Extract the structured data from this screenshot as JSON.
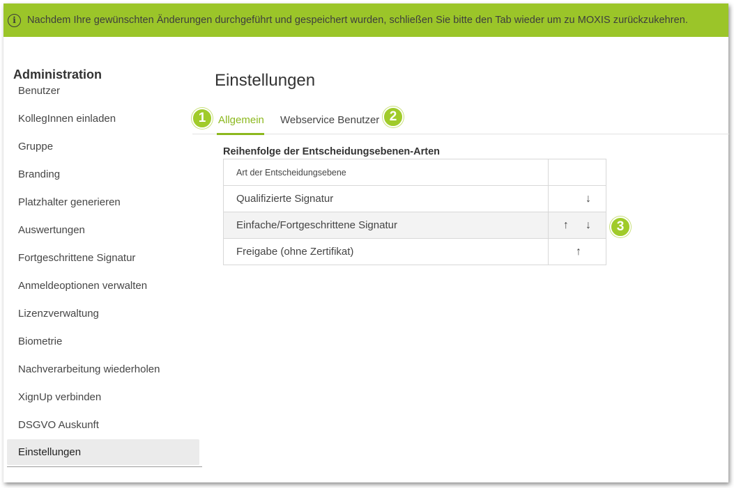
{
  "banner": {
    "icon": "info-icon",
    "message": "Nachdem Ihre gewünschten Änderungen durchgeführt und gespeichert wurden, schließen Sie bitte den Tab wieder um zu MOXIS zurückzukehren."
  },
  "sidebar": {
    "title": "Administration",
    "items": [
      {
        "label": "Benutzer"
      },
      {
        "label": "KollegInnen einladen"
      },
      {
        "label": "Gruppe"
      },
      {
        "label": "Branding"
      },
      {
        "label": "Platzhalter generieren"
      },
      {
        "label": "Auswertungen"
      },
      {
        "label": "Fortgeschrittene Signatur"
      },
      {
        "label": "Anmeldeoptionen verwalten"
      },
      {
        "label": "Lizenzverwaltung"
      },
      {
        "label": "Biometrie"
      },
      {
        "label": "Nachverarbeitung wiederholen"
      },
      {
        "label": "XignUp verbinden"
      },
      {
        "label": "DSGVO Auskunft"
      },
      {
        "label": "Einstellungen",
        "active": true
      }
    ]
  },
  "main": {
    "title": "Einstellungen",
    "tabs": [
      {
        "label": "Allgemein",
        "active": true
      },
      {
        "label": "Webservice Benutzer"
      }
    ],
    "section_title": "Reihenfolge der Entscheidungsebenen-Arten",
    "table": {
      "column_header": "Art der Entscheidungsebene",
      "rows": [
        {
          "label": "Qualifizierte Signatur",
          "up": false,
          "down": true
        },
        {
          "label": "Einfache/Fortgeschrittene Signatur",
          "up": true,
          "down": true
        },
        {
          "label": "Freigabe (ohne Zertifikat)",
          "up": true,
          "down": false
        }
      ],
      "up_glyph": "↑",
      "down_glyph": "↓"
    }
  },
  "badges": [
    "1",
    "2",
    "3"
  ],
  "colors": {
    "banner_bg": "#9bc529",
    "accent": "#8cb81e",
    "badge": "#a0cb2a",
    "active_item_bg": "#ebebeb"
  }
}
